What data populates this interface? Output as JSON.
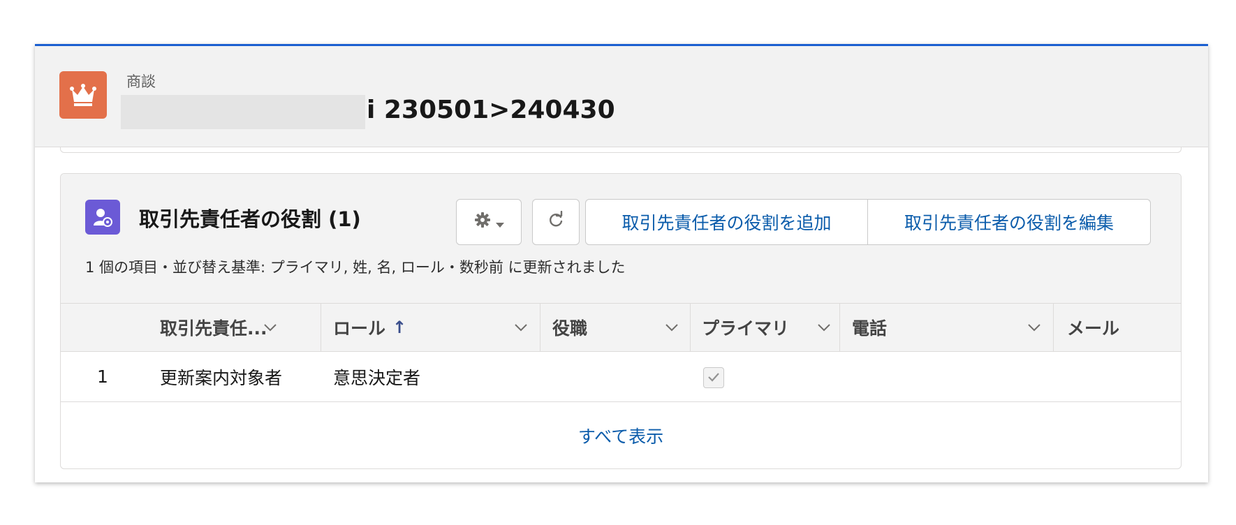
{
  "colors": {
    "accent": "#1b5fd0",
    "record_icon_bg": "#e3704a",
    "card_icon_bg": "#6b5ad6",
    "link": "#0b5cab"
  },
  "record": {
    "type_label": "商談",
    "name_visible_suffix": "i 230501>240430",
    "icon": "crown-icon"
  },
  "related_list": {
    "title": "取引先責任者の役割 (1)",
    "icon": "contact-role-icon",
    "subtitle": "1 個の項目・並び替え基準: プライマリ, 姓, 名, ロール・数秒前 に更新されました",
    "buttons": {
      "settings_icon": "gear-icon",
      "refresh_icon": "refresh-icon",
      "add_label": "取引先責任者の役割を追加",
      "edit_label": "取引先責任者の役割を編集"
    },
    "columns": [
      {
        "label": "取引先責任..."
      },
      {
        "label": "ロール",
        "sort_icon": "↑"
      },
      {
        "label": "役職"
      },
      {
        "label": "プライマリ"
      },
      {
        "label": "電話"
      },
      {
        "label": "メール"
      }
    ],
    "rows": [
      {
        "num": "1",
        "contact": "更新案内対象者",
        "role": "意思決定者",
        "title": "",
        "primary": true,
        "phone": "",
        "email": ""
      }
    ],
    "view_all_label": "すべて表示"
  }
}
